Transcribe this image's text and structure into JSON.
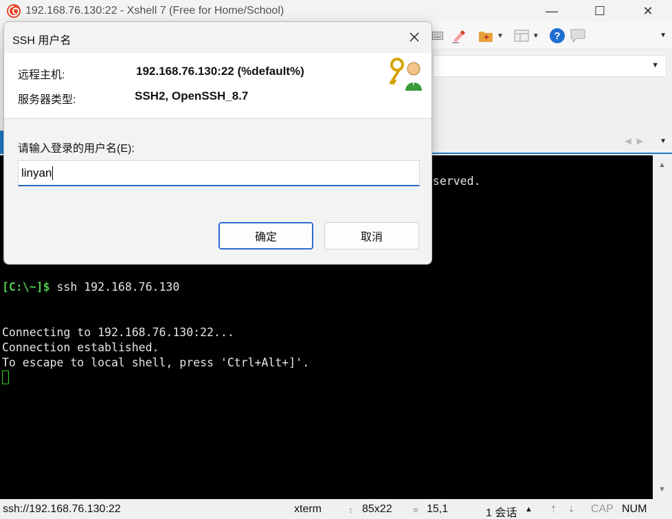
{
  "window": {
    "title": "192.168.76.130:22 - Xshell 7 (Free for Home/School)",
    "controls": {
      "minimize": "—",
      "maximize": "☐",
      "close": "✕"
    }
  },
  "terminal": {
    "partial_line": "eserved.",
    "prompt": "[C:\\~]$",
    "command": " ssh 192.168.76.130",
    "lines": [
      "Connecting to 192.168.76.130:22...",
      "Connection established.",
      "To escape to local shell, press 'Ctrl+Alt+]'."
    ]
  },
  "dialog": {
    "title": "SSH 用户名",
    "remote_host_label": "远程主机:",
    "remote_host_value": "192.168.76.130:22 (%default%)",
    "server_type_label": "服务器类型:",
    "server_type_value": "SSH2, OpenSSH_8.7",
    "prompt": "请输入登录的用户名(E):",
    "username_value": "linyan",
    "ok_label": "确定",
    "cancel_label": "取消"
  },
  "statusbar": {
    "connection": "ssh://192.168.76.130:22",
    "term_type": "xterm",
    "size": "85x22",
    "cursor_pos": "15,1",
    "sessions": "1 会话",
    "caps": "CAP",
    "num": "NUM"
  },
  "colors": {
    "accent": "#1e78c8",
    "prompt_green": "#4ec94e",
    "terminal_bg": "#000000"
  }
}
